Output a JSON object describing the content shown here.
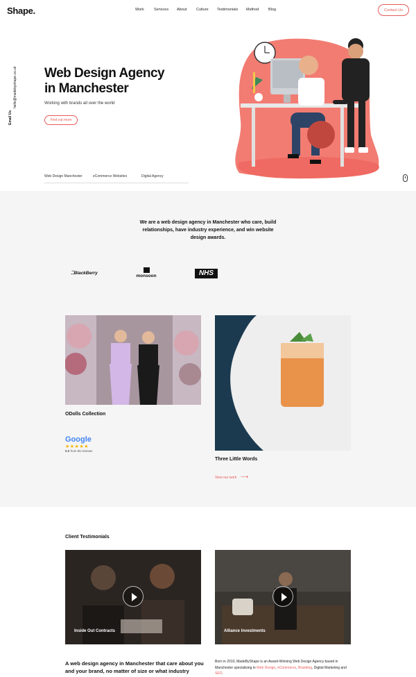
{
  "header": {
    "logo": "Shape.",
    "nav": [
      "Work",
      "Services",
      "About",
      "Culture",
      "Testimonials",
      "Method",
      "Blog"
    ],
    "contact_label": "Contact Us"
  },
  "side": {
    "email_label": "Email Us",
    "email": "hello@madebyshape.co.uk"
  },
  "hero": {
    "title_line1": "Web Design Agency",
    "title_line2": "in Manchester",
    "subtitle": "Working with brands all over the world",
    "cta": "Find out more",
    "tags": [
      "Web Design Manchester",
      "eCommerce Websites",
      "Digital Agency"
    ]
  },
  "intro": {
    "text": "We are a web design agency in Manchester who care, build relationships, have industry experience, and win website design awards."
  },
  "clients": [
    "BlackBerry",
    "monsoon",
    "NHS"
  ],
  "work": {
    "card1_title": "ODolls Collection",
    "card2_title": "Three Little Words",
    "view_link": "View our work",
    "google": {
      "name": "Google",
      "stars": "★★★★★",
      "rating": "5.0",
      "reviews": "from 65 reviews"
    }
  },
  "testimonials": {
    "heading": "Client Testimonials",
    "videos": [
      {
        "label": "Inside Out Contracts"
      },
      {
        "label": "Alliance Investments"
      }
    ]
  },
  "bottom": {
    "left_text": "A web design agency in Manchester that care about you and your brand, no matter of size or what industry",
    "right_pre": "Born in 2010, MadeByShape is an Award-Winning Web Design Agency based in Manchester specialising in ",
    "right_link1": "Web Design",
    "right_sep1": ", ",
    "right_link2": "eCommerce",
    "right_sep2": ", ",
    "right_link3": "Branding",
    "right_mid": ", Digital Marketing and ",
    "right_link4": "SEO",
    "right_end": "."
  },
  "colors": {
    "accent": "#e85a5a",
    "grey_bg": "#f5f5f5"
  }
}
